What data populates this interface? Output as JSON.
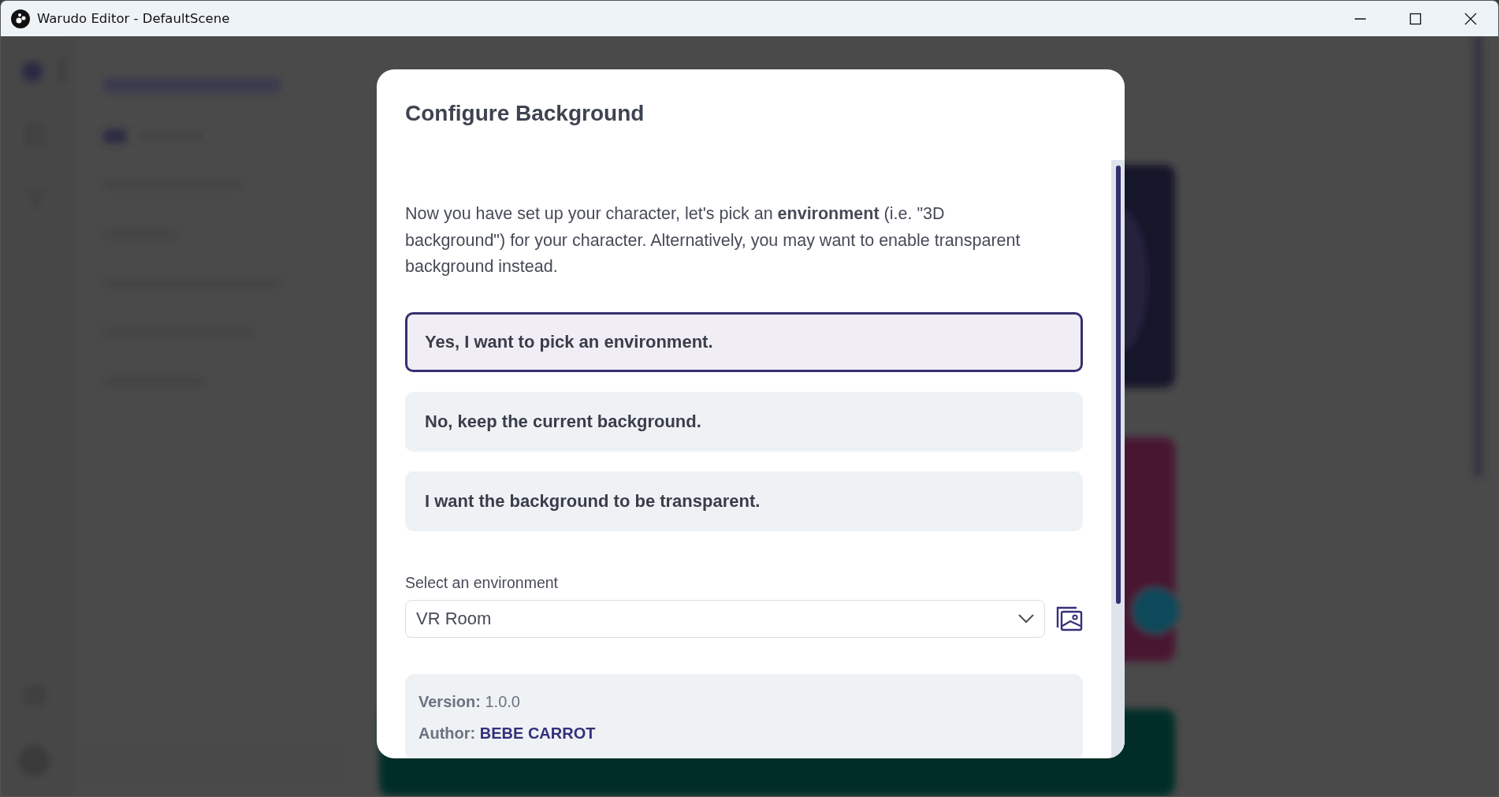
{
  "window": {
    "title": "Warudo Editor - DefaultScene"
  },
  "dialog": {
    "title": "Configure Background",
    "intro": "Now you have set up your character, let's pick an **environment** (i.e. \"3D background\") for your character. Alternatively, you may want to enable transparent background instead.",
    "options": [
      {
        "label": "Yes, I want to pick an environment.",
        "selected": true
      },
      {
        "label": "No, keep the current background.",
        "selected": false
      },
      {
        "label": "I want the background to be transparent.",
        "selected": false
      }
    ],
    "environment": {
      "label": "Select an environment",
      "value": "VR Room"
    },
    "details": [
      {
        "kind": "text",
        "label": "Version:",
        "value": "1.0.0"
      },
      {
        "kind": "link",
        "label": "Author:",
        "value": "BEBE CARROT"
      }
    ]
  }
}
